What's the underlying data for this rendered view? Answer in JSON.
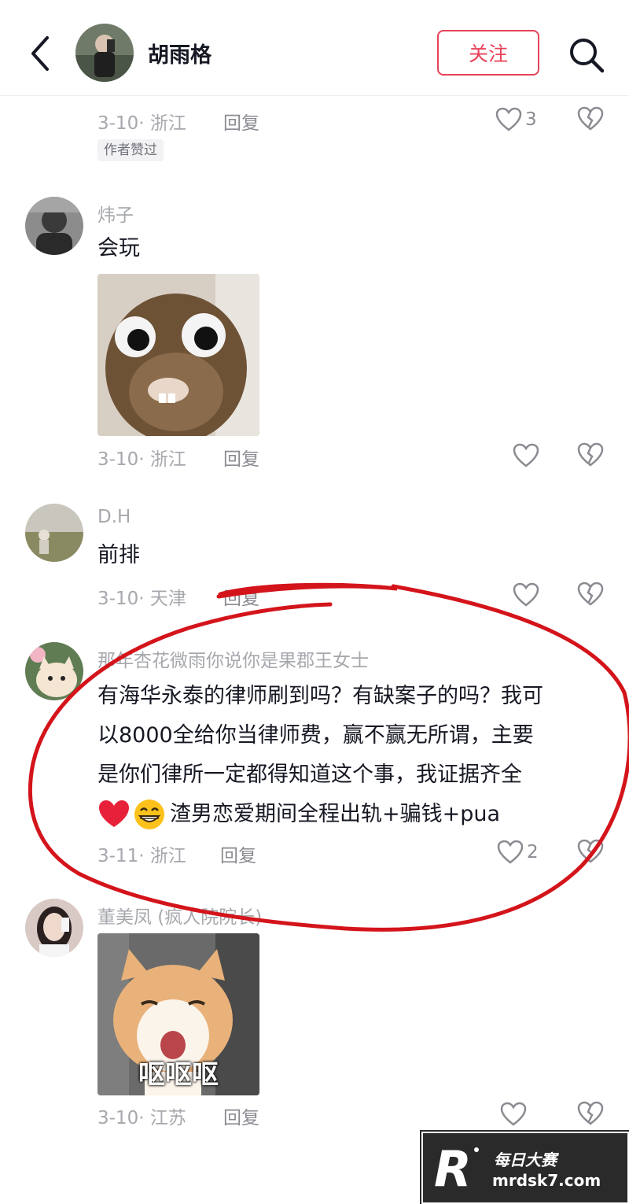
{
  "header": {
    "name": "胡雨格",
    "follow_label": "关注"
  },
  "top_comment": {
    "meta": "3-10· 浙江",
    "reply": "回复",
    "likes": "3",
    "author_tag": "作者赞过"
  },
  "comments": [
    {
      "username": "炜子",
      "text": "会玩",
      "meta": "3-10· 浙江",
      "reply": "回复",
      "likes": ""
    },
    {
      "username": "D.H",
      "text": "前排",
      "meta": "3-10· 天津",
      "reply": "回复",
      "likes": ""
    },
    {
      "username": "那年杏花微雨你说你是果郡王女士",
      "text_lines": [
        "有海华永泰的律师刷到吗？有缺案子的吗？我可",
        "以8000全给你当律师费，赢不赢无所谓，主要",
        "是你们律所一定都得知道这个事，我证据齐全",
        "渣男恋爱期间全程出轨+骗钱+pua"
      ],
      "meta": "3-11· 浙江",
      "reply": "回复",
      "likes": "2"
    },
    {
      "username": "董美凤 (疯人院院长)",
      "sticker_text": "呕呕呕",
      "meta": "3-10· 江苏",
      "reply": "回复",
      "likes": ""
    }
  ],
  "watermark": {
    "line1": "每日大赛",
    "line2": "mrdsk7.com"
  },
  "colors": {
    "accent": "#e8435a",
    "annotation_circle": "#d4141b",
    "secondary_text": "#a6a8ad"
  }
}
